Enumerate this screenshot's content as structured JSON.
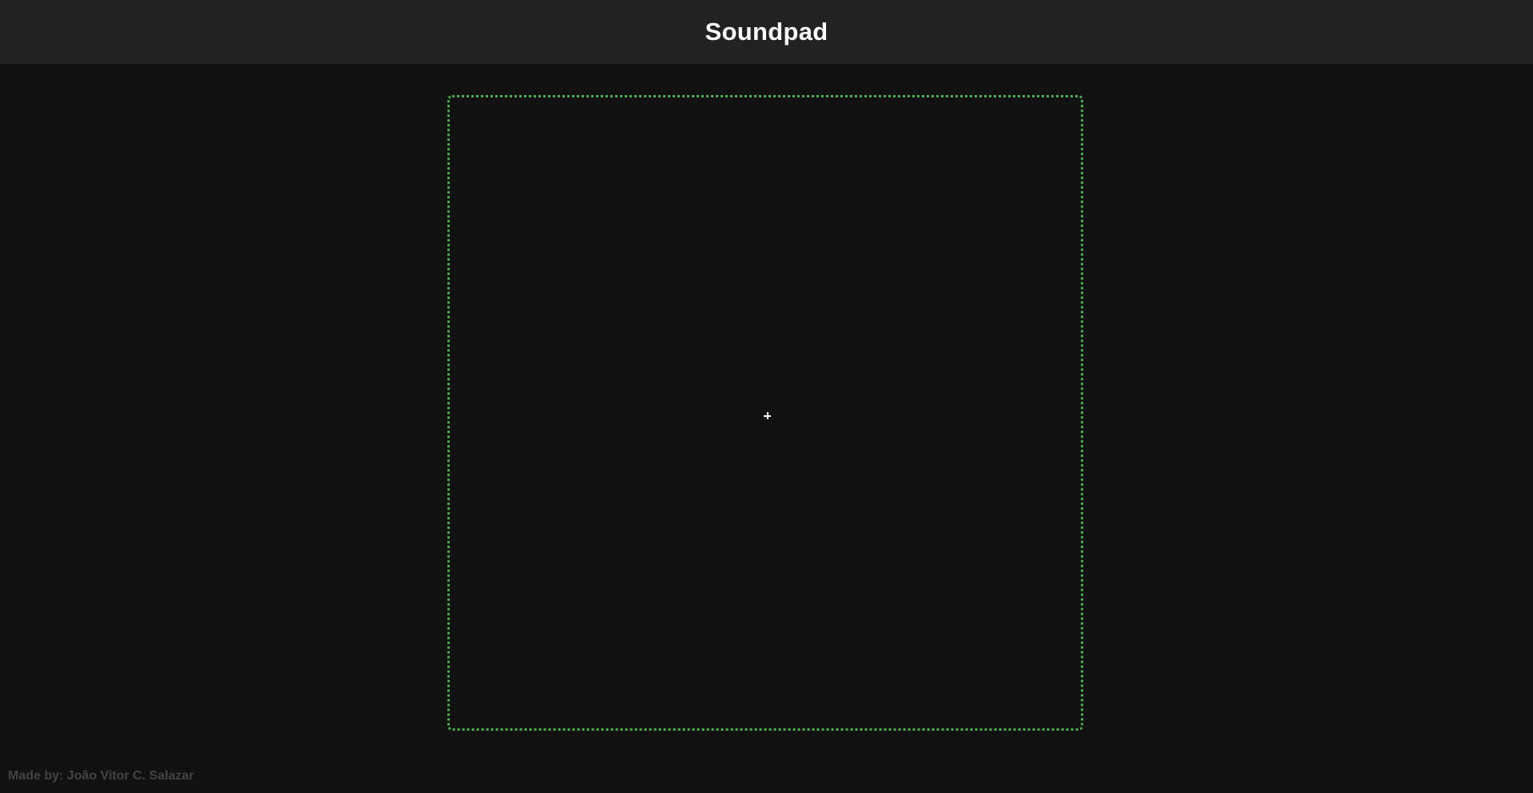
{
  "header": {
    "title": "Soundpad"
  },
  "pad": {
    "border_color": "#4caf50",
    "cursor_icon": "crosshair-icon"
  },
  "footer": {
    "credit": "Made by: João Vitor C. Salazar"
  },
  "colors": {
    "background": "#111111",
    "header_background": "#222222",
    "title_text": "#ffffff",
    "footer_text": "#444444"
  }
}
